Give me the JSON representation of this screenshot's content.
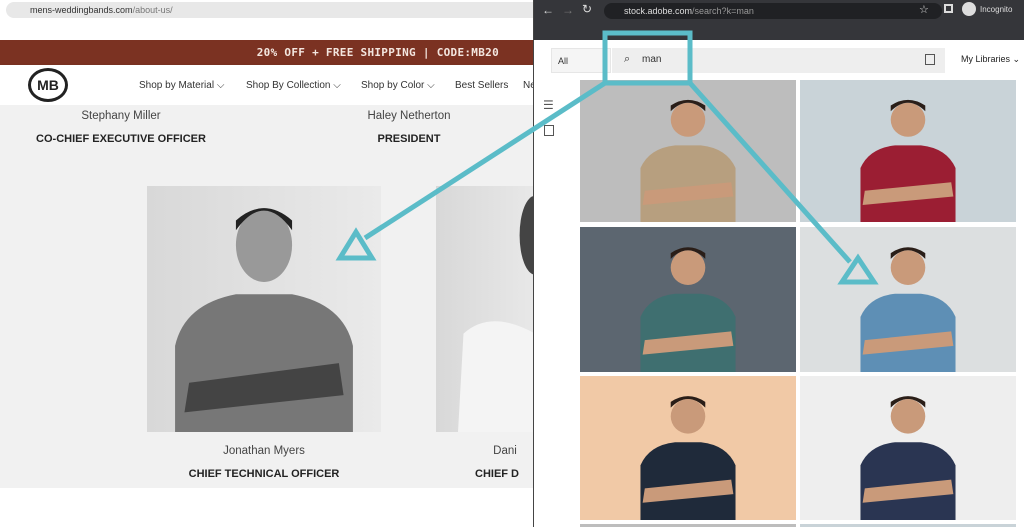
{
  "left_browser": {
    "url_domain": "mens-weddingbands.com",
    "url_path": "/about-us/",
    "promo": "20% OFF + FREE SHIPPING | CODE:MB20",
    "logo": "MB",
    "nav": [
      {
        "label": "Shop by Material ⌵"
      },
      {
        "label": "Shop By Collection ⌵"
      },
      {
        "label": "Shop by Color ⌵"
      },
      {
        "label": "Best Sellers"
      },
      {
        "label": "Ne"
      }
    ],
    "team": [
      {
        "name": "Stephany Miller",
        "role": "CO-CHIEF EXECUTIVE OFFICER"
      },
      {
        "name": "Haley Netherton",
        "role": "PRESIDENT"
      },
      {
        "name": "Jonathan Myers",
        "role": "CHIEF TECHNICAL OFFICER"
      },
      {
        "name": "Dani",
        "role": "CHIEF D"
      }
    ]
  },
  "right_browser": {
    "url_domain": "stock.adobe.com",
    "url_path": "/search?k=man",
    "profile_label": "Incognito",
    "filter_select": "All",
    "search_value": "man",
    "my_libraries": "My Libraries ⌄",
    "results_colors": [
      "#bdbdbd",
      "#c9d3d8",
      "#5c6670",
      "#dcdfe0",
      "#f1c9a6",
      "#eeeeee"
    ],
    "shirt_colors": [
      "#b79f7f",
      "#9b1e33",
      "#3f6f70",
      "#5e8fb5",
      "#1f2a3a",
      "#2a3552"
    ]
  },
  "annotation_color": "#5bbcc8"
}
